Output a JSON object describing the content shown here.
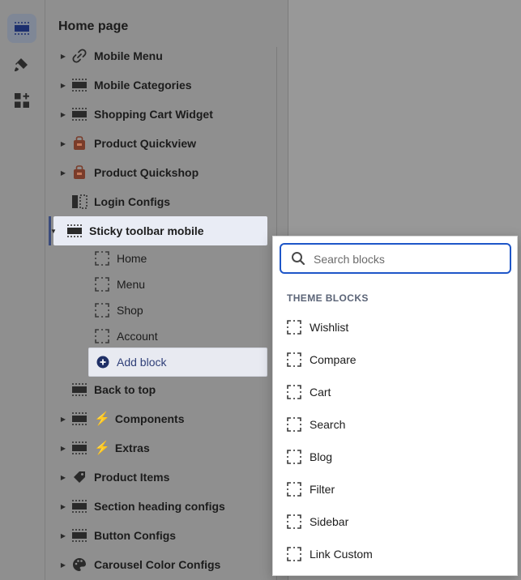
{
  "panel": {
    "title": "Home page"
  },
  "tree": {
    "items": [
      {
        "label": "Mobile Menu",
        "icon": "link-icon"
      },
      {
        "label": "Mobile Categories",
        "icon": "section-icon"
      },
      {
        "label": "Shopping Cart Widget",
        "icon": "section-icon"
      },
      {
        "label": "Product Quickview",
        "icon": "app-block-icon"
      },
      {
        "label": "Product Quickshop",
        "icon": "app-block-icon"
      },
      {
        "label": "Login Configs",
        "icon": "sidebar-layout-icon"
      },
      {
        "label": "Sticky toolbar mobile",
        "icon": "section-icon"
      },
      {
        "label": "Back to top",
        "icon": "section-icon"
      },
      {
        "label": "Components",
        "icon": "section-icon",
        "prefix": "⚡"
      },
      {
        "label": "Extras",
        "icon": "section-icon",
        "prefix": "⚡"
      },
      {
        "label": "Product Items",
        "icon": "tag-icon"
      },
      {
        "label": "Section heading configs",
        "icon": "section-icon"
      },
      {
        "label": "Button Configs",
        "icon": "section-icon"
      },
      {
        "label": "Carousel Color Configs",
        "icon": "palette-icon"
      }
    ],
    "children": [
      {
        "label": "Home"
      },
      {
        "label": "Menu"
      },
      {
        "label": "Shop"
      },
      {
        "label": "Account"
      }
    ],
    "add_block": "Add block"
  },
  "popover": {
    "search_placeholder": "Search blocks",
    "section_heading": "THEME BLOCKS",
    "items": [
      {
        "label": "Wishlist"
      },
      {
        "label": "Compare"
      },
      {
        "label": "Cart"
      },
      {
        "label": "Search"
      },
      {
        "label": "Blog"
      },
      {
        "label": "Filter"
      },
      {
        "label": "Sidebar"
      },
      {
        "label": "Link Custom"
      }
    ]
  },
  "colors": {
    "accent": "#1e56c8",
    "selected_bar": "#3a4b7c",
    "bolt": "#e8a400"
  }
}
